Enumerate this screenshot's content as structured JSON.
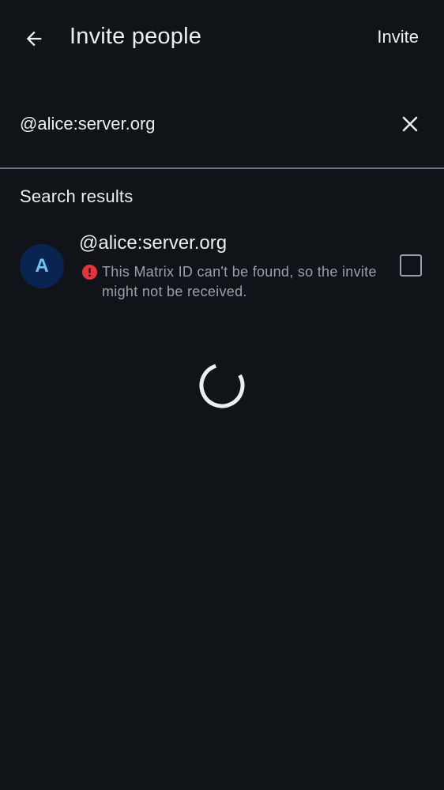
{
  "header": {
    "title": "Invite people",
    "action_label": "Invite",
    "back_icon": "arrow-left-icon"
  },
  "search": {
    "value": "@alice:server.org",
    "placeholder": "",
    "clear_icon": "close-icon"
  },
  "results": {
    "section_label": "Search results",
    "items": [
      {
        "avatar_letter": "A",
        "user_id": "@alice:server.org",
        "warning": "This Matrix ID can't be found, so the invite might not be received.",
        "warning_icon": "error-icon",
        "checked": false
      }
    ]
  },
  "loading": {
    "icon": "spinner-icon"
  },
  "colors": {
    "background": "#101318",
    "text_primary": "#ebeef2",
    "text_secondary": "#9ba1aa",
    "avatar_bg": "#0a2451",
    "avatar_fg": "#6fc5eb",
    "error": "#e5333b"
  }
}
